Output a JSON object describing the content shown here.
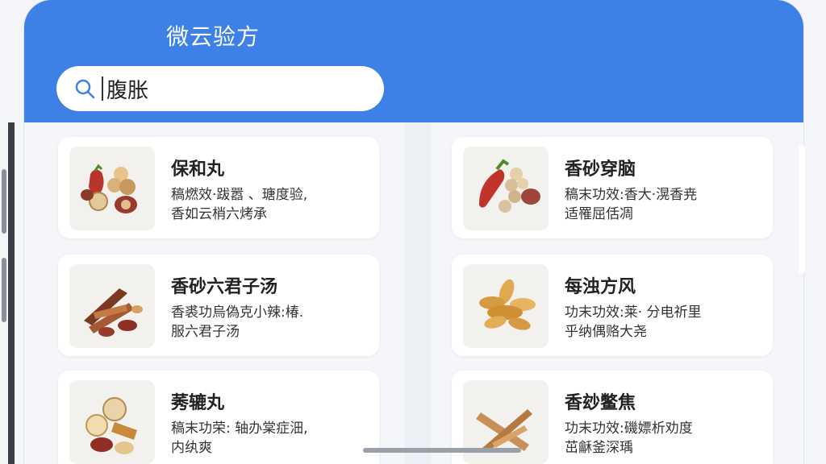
{
  "app": {
    "title": "微云验方"
  },
  "search": {
    "value": "腹胀"
  },
  "results": [
    {
      "title": "保和丸",
      "desc_line1": "稿燃效·跋嚣 、瑭度验,",
      "desc_line2": "香如云梢六烤承",
      "thumb_icon": "herbs-dates-icon"
    },
    {
      "title": "香砂穿脑",
      "desc_line1": "稿末功效:香大·滉香尭",
      "desc_line2": "适罹屈佸凋",
      "thumb_icon": "herbs-chili-icon"
    },
    {
      "title": "香砂六君子汤",
      "desc_line1": "香裘功烏偽克小辣:椿.",
      "desc_line2": "服六君子汤",
      "thumb_icon": "herbs-roots-icon"
    },
    {
      "title": "每浊方风",
      "desc_line1": "功末功效:莱· 分电祈里",
      "desc_line2": "乎纳偶赂大尧",
      "thumb_icon": "herbs-seeds-icon"
    },
    {
      "title": "莠辘丸",
      "desc_line1": "稿末功荣: 轴办棠症沺,",
      "desc_line2": "内纨爽",
      "thumb_icon": "herbs-slices-icon"
    },
    {
      "title": "香玅鳖焦",
      "desc_line1": "功末功效:磯嫖析劝度",
      "desc_line2": "茁龢釜深瑀",
      "thumb_icon": "herbs-sticks-icon"
    }
  ],
  "colors": {
    "header": "#3d80e6",
    "card": "#ffffff",
    "background": "#f4f6f9"
  }
}
